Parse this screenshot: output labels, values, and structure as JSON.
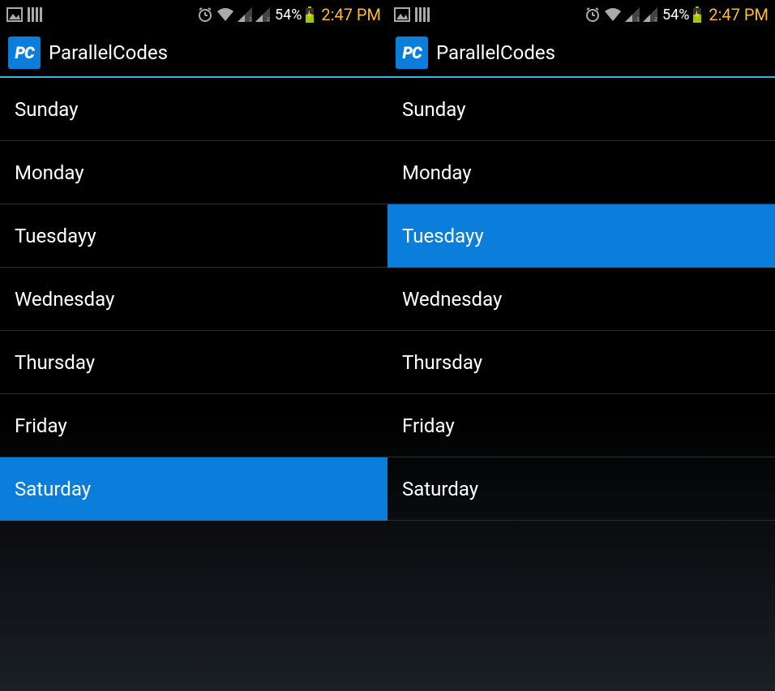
{
  "status": {
    "battery_pct": "54%",
    "clock": "2:47 PM"
  },
  "app": {
    "icon_text": "PC",
    "title": "ParallelCodes"
  },
  "left": {
    "items": [
      {
        "label": "Sunday",
        "selected": false
      },
      {
        "label": "Monday",
        "selected": false
      },
      {
        "label": "Tuesdayy",
        "selected": false
      },
      {
        "label": "Wednesday",
        "selected": false
      },
      {
        "label": "Thursday",
        "selected": false
      },
      {
        "label": "Friday",
        "selected": false
      },
      {
        "label": "Saturday",
        "selected": true
      }
    ]
  },
  "right": {
    "items": [
      {
        "label": "Sunday",
        "selected": false
      },
      {
        "label": "Monday",
        "selected": false
      },
      {
        "label": "Tuesdayy",
        "selected": true
      },
      {
        "label": "Wednesday",
        "selected": false
      },
      {
        "label": "Thursday",
        "selected": false
      },
      {
        "label": "Friday",
        "selected": false
      },
      {
        "label": "Saturday",
        "selected": false
      }
    ]
  }
}
